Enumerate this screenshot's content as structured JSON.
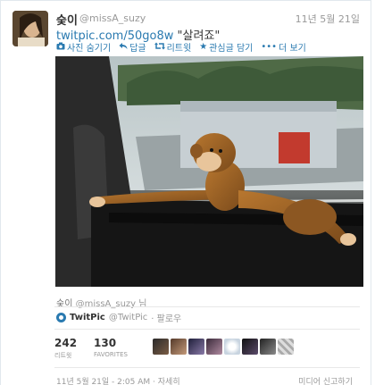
{
  "tweet": {
    "author_name": "숮이",
    "author_handle": "@missA_suzy",
    "date": "11년 5월 21일",
    "link_text": "twitpic.com/50go8w",
    "text": "\"살려죠\""
  },
  "actions": [
    {
      "icon": "camera-icon",
      "label": "사진 숨기기"
    },
    {
      "icon": "reply-icon",
      "label": "답글"
    },
    {
      "icon": "retweet-icon",
      "label": "리트윗"
    },
    {
      "icon": "star-icon",
      "label": "관심글 담기"
    },
    {
      "icon": "more-icon",
      "label": "더 보기"
    }
  ],
  "media": {
    "credit_name": "숮이",
    "credit_handle": "@missA_suzy",
    "credit_suffix": "님"
  },
  "twitpic": {
    "name": "TwitPic",
    "handle": "@TwitPic",
    "follow": "· 팔로우"
  },
  "stats": {
    "retweets": "242",
    "retweets_label": "리트윗",
    "favorites": "130",
    "favorites_label": "FAVORITES"
  },
  "footer": {
    "timestamp": "11년 5월 21일 - 2:05 AM",
    "details": "· 자세히",
    "report": "미디어 신고하기"
  },
  "colors": {
    "link": "#2a7ab0",
    "muted": "#999999",
    "text": "#333333"
  }
}
